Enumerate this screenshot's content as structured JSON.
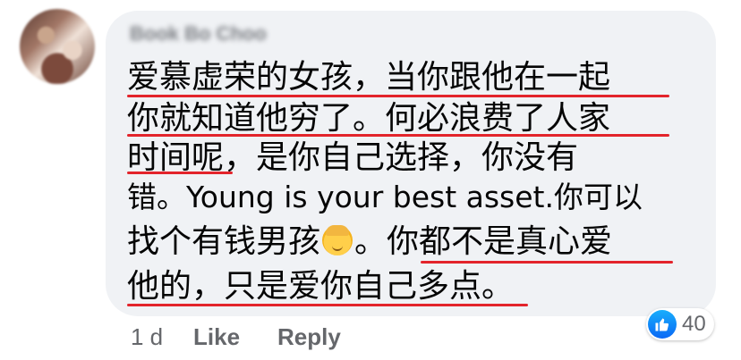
{
  "comment": {
    "author": "Book Bo Choo",
    "lines": [
      "爱慕虚荣的女孩，当你跟他在一起",
      "你就知道他穷了。何必浪费了人家",
      "时间呢，是你自己选择，你没有",
      "错。Young is your best asset.你可以",
      "找个有钱男孩",
      "。你都不是真心爱",
      "他的，只是爱你自己多点。"
    ],
    "emoji": "boy-emoji"
  },
  "actions": {
    "time": "1 d",
    "like": "Like",
    "reply": "Reply"
  },
  "reactions": {
    "count": "40",
    "icon": "like-icon",
    "color": "#1877f2"
  },
  "colors": {
    "underline": "#e3242b",
    "bubble": "#f0f2f5",
    "meta_text": "#65676b"
  }
}
